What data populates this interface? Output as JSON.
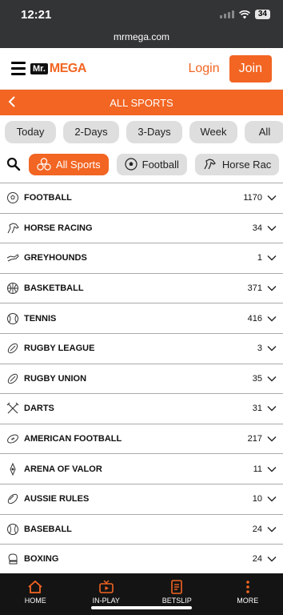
{
  "status_bar": {
    "time": "12:21",
    "battery": "34"
  },
  "browser": {
    "url": "mrmega.com"
  },
  "header": {
    "logo_mr": "Mr.",
    "logo_mega": "MEGA",
    "login": "Login",
    "join": "Join"
  },
  "title_bar": {
    "title": "ALL SPORTS"
  },
  "date_tabs": [
    "Today",
    "2-Days",
    "3-Days",
    "Week",
    "All"
  ],
  "sport_pills": [
    "All Sports",
    "Football",
    "Horse Rac"
  ],
  "sports": [
    {
      "name": "FOOTBALL",
      "count": "1170",
      "icon": "football-icon"
    },
    {
      "name": "HORSE RACING",
      "count": "34",
      "icon": "horse-icon"
    },
    {
      "name": "GREYHOUNDS",
      "count": "1",
      "icon": "greyhound-icon"
    },
    {
      "name": "BASKETBALL",
      "count": "371",
      "icon": "basketball-icon"
    },
    {
      "name": "TENNIS",
      "count": "416",
      "icon": "tennis-icon"
    },
    {
      "name": "RUGBY LEAGUE",
      "count": "3",
      "icon": "rugby-ball-icon"
    },
    {
      "name": "RUGBY UNION",
      "count": "35",
      "icon": "rugby-ball-icon"
    },
    {
      "name": "DARTS",
      "count": "31",
      "icon": "darts-icon"
    },
    {
      "name": "AMERICAN FOOTBALL",
      "count": "217",
      "icon": "american-football-icon"
    },
    {
      "name": "ARENA OF VALOR",
      "count": "11",
      "icon": "arena-of-valor-icon"
    },
    {
      "name": "AUSSIE RULES",
      "count": "10",
      "icon": "aussie-rules-icon"
    },
    {
      "name": "BASEBALL",
      "count": "24",
      "icon": "baseball-icon"
    },
    {
      "name": "BOXING",
      "count": "24",
      "icon": "boxing-icon"
    }
  ],
  "bottom_nav": {
    "home": "HOME",
    "in_play": "IN-PLAY",
    "betslip": "BETSLIP",
    "more": "MORE"
  },
  "colors": {
    "accent": "#f26522",
    "nav_bg": "#141414",
    "status_bg": "#333436"
  }
}
